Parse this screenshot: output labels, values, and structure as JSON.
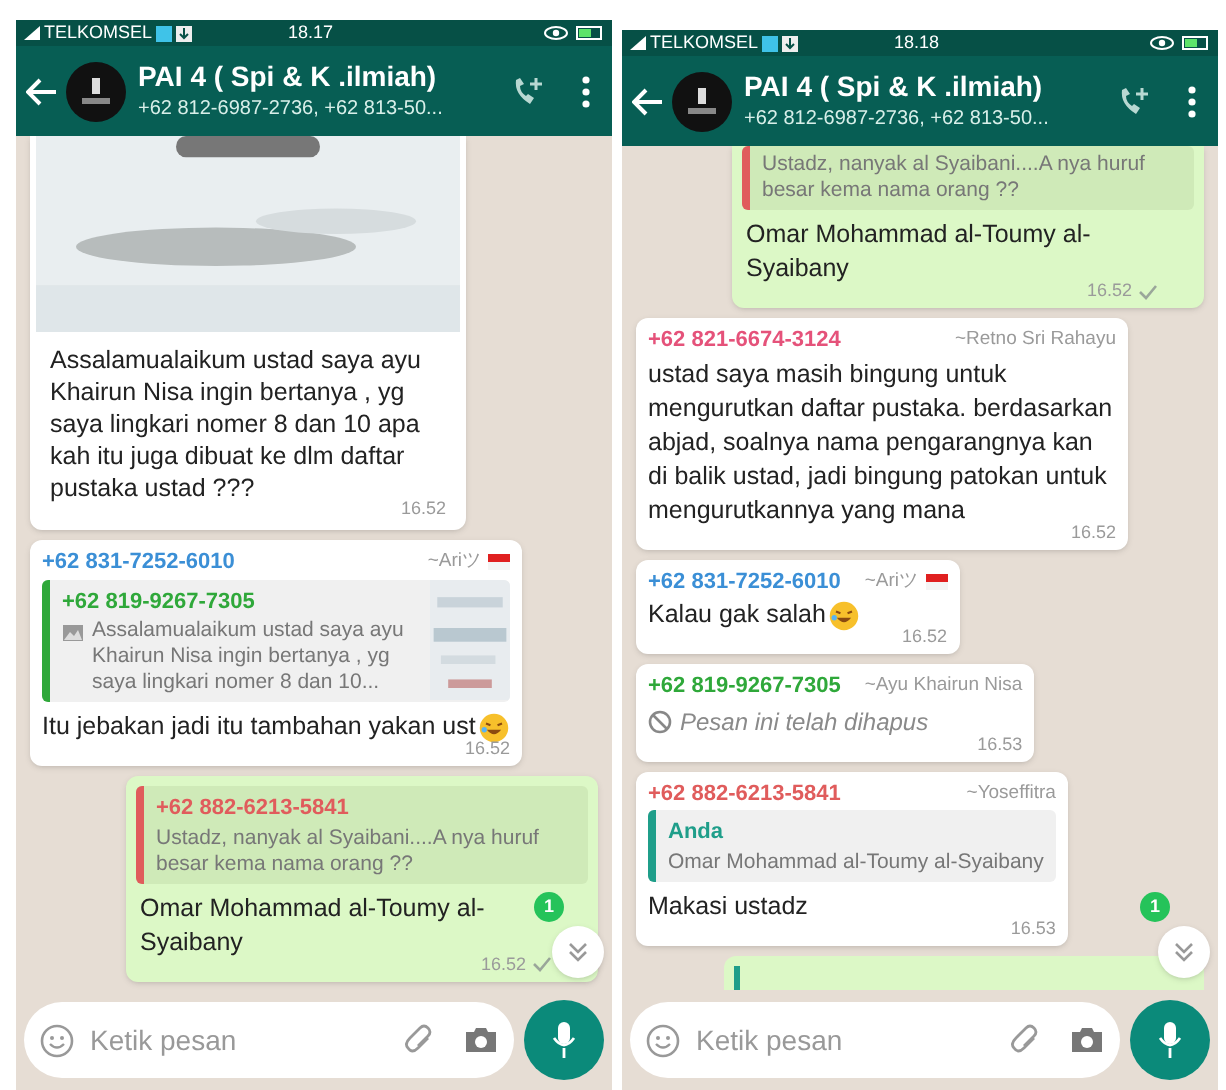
{
  "screens": [
    {
      "status_bar": {
        "carrier": "TELKOMSEL",
        "time": "18.17"
      },
      "header": {
        "title": "PAI 4 ( Spi & K .ilmiah)",
        "subtitle": "+62 812-6987-2736, +62 813-50..."
      },
      "messages": [
        {
          "text": "Assalamualaikum ustad saya ayu Khairun Nisa ingin bertanya , yg saya lingkari nomer 8 dan 10 apa kah itu juga dibuat ke dlm daftar pustaka ustad ???",
          "time": "16.52"
        },
        {
          "kind": "incoming",
          "sender": "+62 831-7252-6010",
          "color": "#3b8fd6",
          "name": "~Ariツ",
          "flag": true,
          "quote": {
            "sender": "+62 819-9267-7305",
            "color": "#2fa83a",
            "text": "Assalamualaikum ustad saya ayu Khairun Nisa ingin bertanya , yg saya lingkari nomer 8 dan 10...",
            "photo": true
          },
          "text": "Itu jebakan jadi itu tambahan yakan ust",
          "emoji": true,
          "time": "16.52"
        },
        {
          "kind": "outgoing",
          "quote": {
            "sender": "+62 882-6213-5841",
            "color": "#e05c5c",
            "text": "Ustadz, nanyak al Syaibani....A nya huruf besar kema nama orang ??"
          },
          "text": "Omar Mohammad al-Toumy al-Syaibany",
          "time": "16.52"
        }
      ],
      "unread_badge": "1",
      "composer": {
        "placeholder": "Ketik pesan"
      }
    },
    {
      "status_bar": {
        "carrier": "TELKOMSEL",
        "time": "18.18"
      },
      "header": {
        "title": "PAI 4 ( Spi & K .ilmiah)",
        "subtitle": "+62 812-6987-2736, +62 813-50..."
      },
      "messages": [
        {
          "kind": "outgoing",
          "quote": {
            "color": "#e05c5c",
            "text": "Ustadz, nanyak al Syaibani....A nya huruf besar kema nama orang ??"
          },
          "text": "Omar Mohammad al-Toumy al-Syaibany",
          "time": "16.52"
        },
        {
          "kind": "incoming",
          "sender": "+62 821-6674-3124",
          "color": "#e5527a",
          "name": "~Retno Sri Rahayu",
          "text": "ustad saya masih bingung untuk mengurutkan daftar pustaka. berdasarkan abjad, soalnya nama pengarangnya kan di balik ustad, jadi bingung patokan untuk mengurutkannya yang mana",
          "time": "16.52"
        },
        {
          "kind": "incoming",
          "sender": "+62 831-7252-6010",
          "color": "#3b8fd6",
          "name": "~Ariツ",
          "flag": true,
          "text": "Kalau gak salah",
          "emoji": true,
          "time": "16.52"
        },
        {
          "kind": "deleted",
          "sender": "+62 819-9267-7305",
          "color": "#2fa83a",
          "name": "~Ayu Khairun Nisa",
          "text": "Pesan ini telah dihapus",
          "time": "16.53"
        },
        {
          "kind": "incoming",
          "sender": "+62 882-6213-5841",
          "color": "#e05c5c",
          "name": "~Yoseffitra",
          "quote": {
            "sender": "Anda",
            "color": "#1f9e8a",
            "text": "Omar Mohammad al-Toumy al-Syaibany"
          },
          "text": "Makasi ustadz",
          "time": "16.53"
        },
        {
          "kind": "outgoing_stub"
        }
      ],
      "unread_badge": "1",
      "composer": {
        "placeholder": "Ketik pesan"
      }
    }
  ]
}
